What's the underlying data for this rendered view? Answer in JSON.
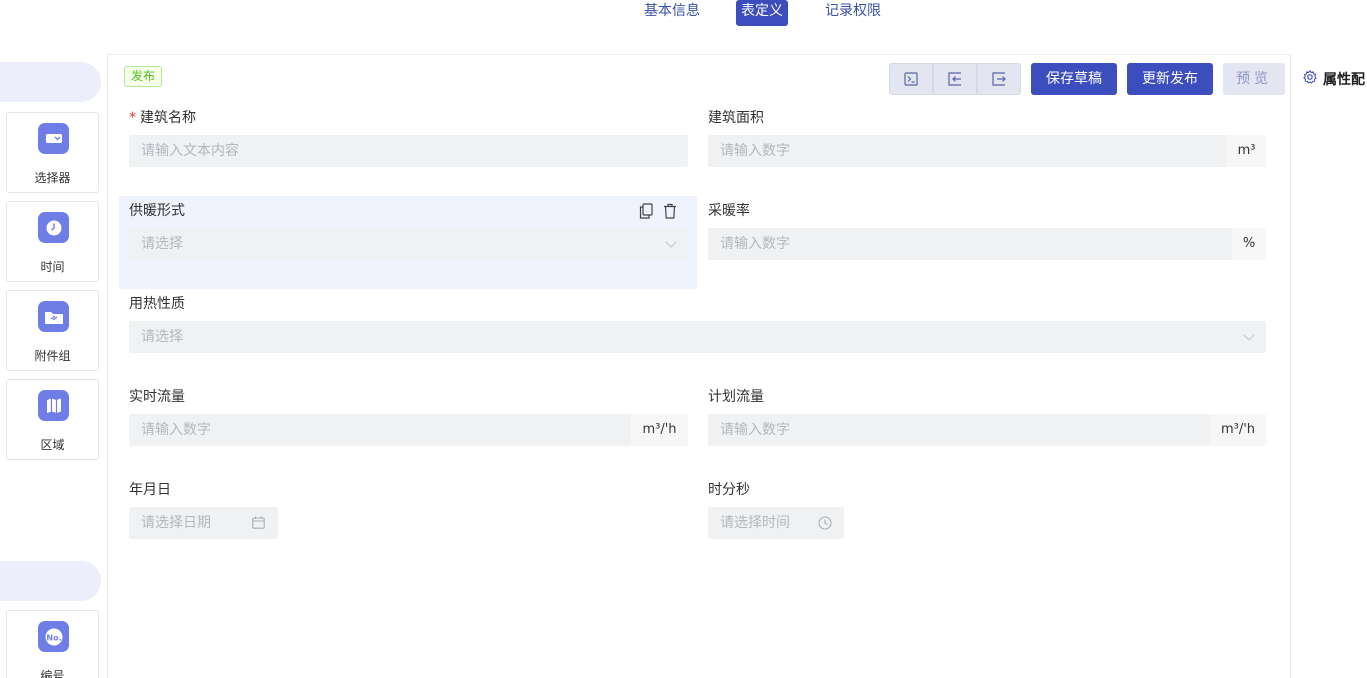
{
  "tabs": [
    {
      "label": "基本信息",
      "active": false
    },
    {
      "label": "表定义",
      "active": true
    },
    {
      "label": "记录权限",
      "active": false
    }
  ],
  "palette": {
    "components": [
      {
        "label": "选择器",
        "icon": "dropdown-select-icon"
      },
      {
        "label": "时间",
        "icon": "clock-icon"
      },
      {
        "label": "附件组",
        "icon": "folder-attachment-icon"
      },
      {
        "label": "区域",
        "icon": "map-icon"
      },
      {
        "label": "编号",
        "icon": "number-no-icon"
      }
    ]
  },
  "toolbar": {
    "status_tag": "发布",
    "save_draft": "保存草稿",
    "update_publish": "更新发布",
    "preview": "预览"
  },
  "form": {
    "building_name": {
      "label": "建筑名称",
      "required": true,
      "placeholder": "请输入文本内容"
    },
    "building_area": {
      "label": "建筑面积",
      "placeholder": "请输入数字",
      "unit": "m³"
    },
    "heating_form": {
      "label": "供暖形式",
      "placeholder": "请选择"
    },
    "heating_rate": {
      "label": "采暖率",
      "placeholder": "请输入数字",
      "unit": "%"
    },
    "heat_nature": {
      "label": "用热性质",
      "placeholder": "请选择"
    },
    "realtime_flow": {
      "label": "实时流量",
      "placeholder": "请输入数字",
      "unit": "m³/'h"
    },
    "planned_flow": {
      "label": "计划流量",
      "placeholder": "请输入数字",
      "unit": "m³/'h"
    },
    "date": {
      "label": "年月日",
      "placeholder": "请选择日期"
    },
    "time": {
      "label": "时分秒",
      "placeholder": "请选择时间"
    }
  },
  "props_panel": {
    "title": "属性配"
  },
  "colors": {
    "primary": "#3c4ebd",
    "icon_bg": "#6f7ee6",
    "selected_bg": "#f0f3fd"
  }
}
